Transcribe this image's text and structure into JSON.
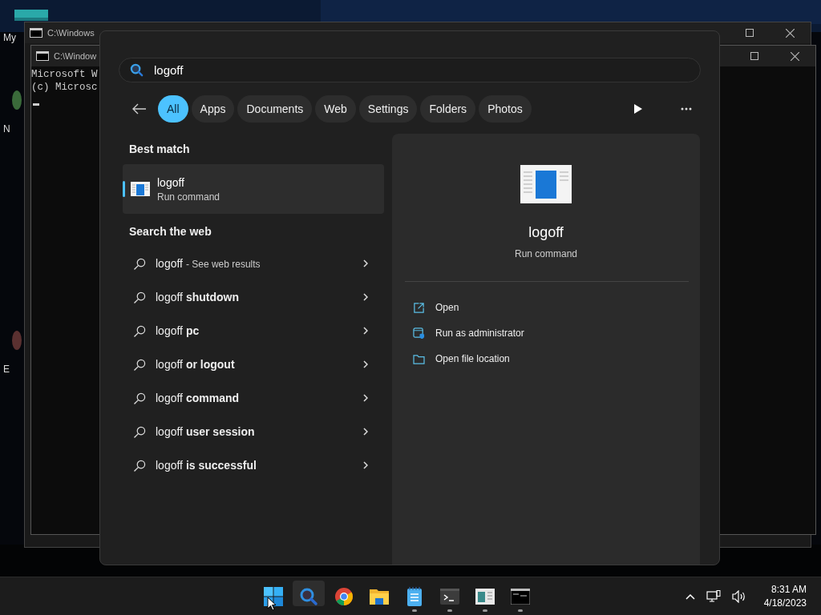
{
  "desktop": {
    "icons": [
      {
        "label": "My",
        "kind": "folder"
      },
      {
        "label": "N",
        "kind": "app"
      },
      {
        "label": "E",
        "kind": "app"
      }
    ]
  },
  "windows": [
    {
      "title": "C:\\Windows"
    },
    {
      "title": "C:\\Window",
      "lines": [
        "Microsoft W",
        "(c) Microsc"
      ]
    }
  ],
  "search": {
    "query": "logoff",
    "filters": [
      {
        "label": "All",
        "selected": true
      },
      {
        "label": "Apps",
        "selected": false
      },
      {
        "label": "Documents",
        "selected": false
      },
      {
        "label": "Web",
        "selected": false
      },
      {
        "label": "Settings",
        "selected": false
      },
      {
        "label": "Folders",
        "selected": false
      },
      {
        "label": "Photos",
        "selected": false
      }
    ],
    "best_match": {
      "heading": "Best match",
      "title": "logoff",
      "subtitle": "Run command",
      "selected": true
    },
    "web": {
      "heading": "Search the web",
      "items": [
        {
          "kind": "results",
          "text": "logoff",
          "note": "- See web results"
        },
        {
          "kind": "suggestion",
          "text": "logoff **shutdown**"
        },
        {
          "kind": "suggestion",
          "text": "logoff **pc**"
        },
        {
          "kind": "suggestion",
          "text": "logoff **or logout**"
        },
        {
          "kind": "suggestion",
          "text": "logoff **command**"
        },
        {
          "kind": "suggestion",
          "text": "logoff **user session**"
        },
        {
          "kind": "suggestion",
          "text": "logoff **is successful**"
        }
      ]
    },
    "preview": {
      "title": "logoff",
      "subtitle": "Run command",
      "actions": [
        {
          "kind": "open",
          "label": "Open"
        },
        {
          "kind": "admin",
          "label": "Run as administrator"
        },
        {
          "kind": "folder",
          "label": "Open file location"
        }
      ]
    }
  },
  "taskbar": {
    "apps": [
      {
        "kind": "start",
        "running": false,
        "active": false
      },
      {
        "kind": "search",
        "running": false,
        "active": true
      },
      {
        "kind": "browser",
        "running": false,
        "active": false
      },
      {
        "kind": "explorer",
        "running": false,
        "active": false
      },
      {
        "kind": "notepad",
        "running": true,
        "active": false
      },
      {
        "kind": "terminal",
        "running": true,
        "active": false
      },
      {
        "kind": "run",
        "running": true,
        "active": false
      },
      {
        "kind": "cmd",
        "running": true,
        "active": false
      }
    ],
    "time": "8:31 AM",
    "date": "4/18/2023"
  }
}
